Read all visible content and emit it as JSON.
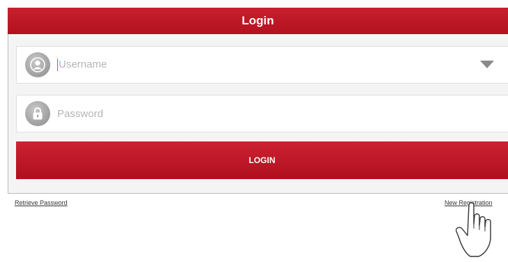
{
  "header": {
    "title": "Login"
  },
  "username_field": {
    "placeholder": "Username"
  },
  "password_field": {
    "placeholder": "Password"
  },
  "login_button": {
    "label": "LOGIN"
  },
  "links": {
    "retrieve_password": "Retrieve Password",
    "new_registration": "New Registration"
  },
  "icons": {
    "username": "user-icon",
    "password": "lock-icon",
    "dropdown": "chevron-down-icon",
    "pointer": "hand-pointer-icon"
  },
  "colors": {
    "accent": "#c01828",
    "background": "#f4f4f4"
  }
}
